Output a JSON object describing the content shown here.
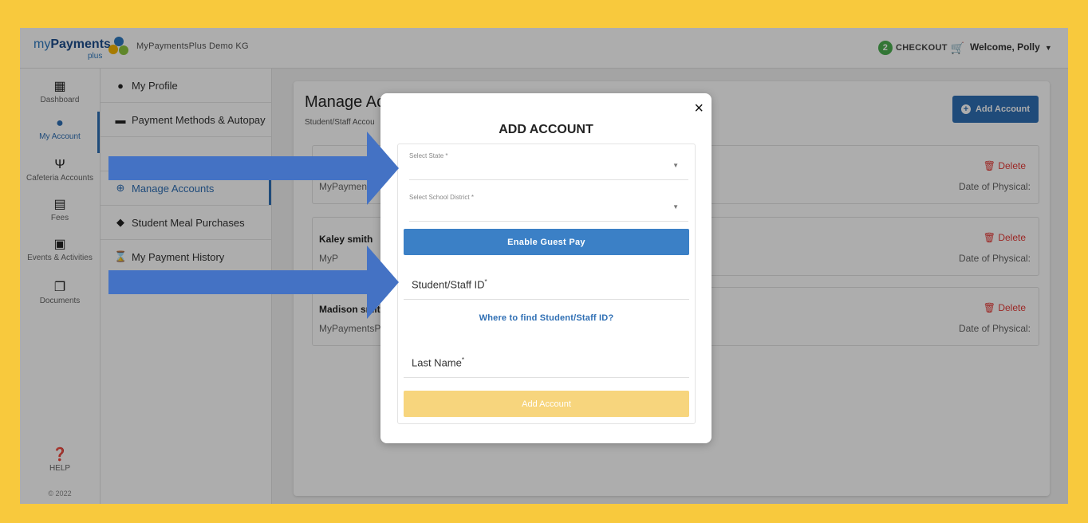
{
  "header": {
    "logo_text": "myPayments",
    "logo_sub": "plus",
    "org": "MyPaymentsPlus Demo KG",
    "cart_count": "2",
    "checkout": "CHECKOUT",
    "welcome": "Welcome, Polly"
  },
  "sidebar": {
    "items": [
      {
        "label": "Dashboard",
        "icon": "dashboard-icon"
      },
      {
        "label": "My Account",
        "icon": "user-circle-icon"
      },
      {
        "label": "Cafeteria Accounts",
        "icon": "utensils-icon"
      },
      {
        "label": "Fees",
        "icon": "clipboard-icon"
      },
      {
        "label": "Events & Activities",
        "icon": "ticket-icon"
      },
      {
        "label": "Documents",
        "icon": "documents-icon"
      }
    ],
    "help": "HELP",
    "copyright": "© 2022"
  },
  "submenu": {
    "items": [
      {
        "label": "My Profile",
        "icon": "user-circle-icon"
      },
      {
        "label": "Payment Methods & Autopay",
        "icon": "credit-card-icon"
      },
      {
        "label": "Manage Accounts",
        "icon": "users-icon"
      },
      {
        "label": "Student Meal Purchases",
        "icon": "shopping-bag-icon"
      },
      {
        "label": "My Payment History",
        "icon": "hourglass-icon"
      }
    ]
  },
  "main": {
    "title": "Manage Acc",
    "subtitle": "Student/Staff Accou",
    "add_button": "Add Account",
    "accounts": [
      {
        "name": "",
        "school": "MyPaymentsP",
        "delete": "Delete",
        "date": "Date of Physical:"
      },
      {
        "name": "Kaley smith",
        "school": "MyP",
        "delete": "Delete",
        "date": "Date of Physical:"
      },
      {
        "name": "Madison smith",
        "school": "MyPaymentsP",
        "delete": "Delete",
        "date": "Date of Physical:"
      }
    ]
  },
  "modal": {
    "title": "ADD ACCOUNT",
    "close": "×",
    "state_label": "Select State",
    "district_label": "Select School District",
    "guest_pay": "Enable Guest Pay",
    "student_id": "Student/Staff ID",
    "find_link": "Where to find Student/Staff ID?",
    "last_name": "Last Name",
    "required": "*",
    "submit": "Add Account"
  },
  "colors": {
    "frame": "#f8c93d",
    "primary": "#2f6fb4",
    "arrow": "#4472c4",
    "submit_disabled": "#f7d57d",
    "danger": "#e53935"
  }
}
